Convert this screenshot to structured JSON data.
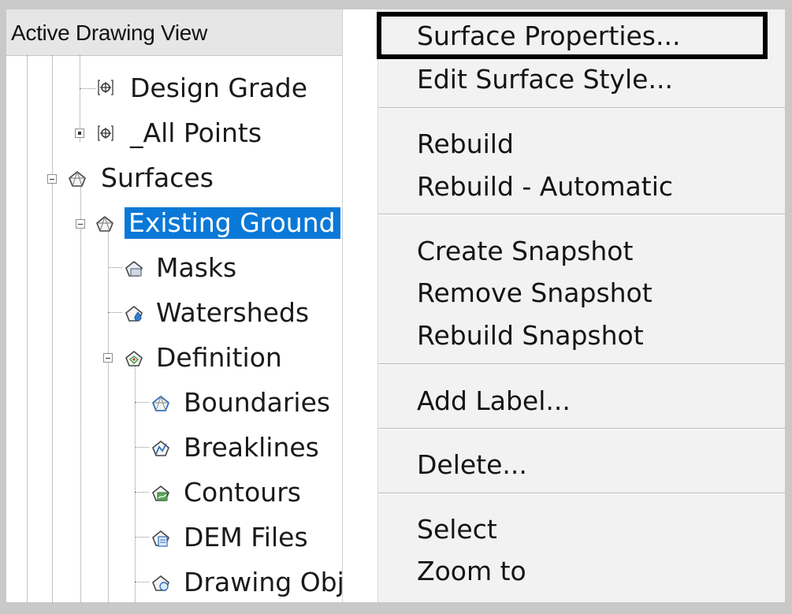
{
  "tree": {
    "header": "Active Drawing View",
    "items": [
      {
        "label": "Design Grade",
        "icon": "point-group-icon"
      },
      {
        "label": "_All Points",
        "icon": "point-group-icon"
      },
      {
        "label": "Surfaces",
        "icon": "surfaces-icon"
      },
      {
        "label": "Existing Ground",
        "icon": "surface-icon",
        "selected": true
      },
      {
        "label": "Masks",
        "icon": "masks-icon"
      },
      {
        "label": "Watersheds",
        "icon": "watersheds-icon"
      },
      {
        "label": "Definition",
        "icon": "definition-icon"
      },
      {
        "label": "Boundaries",
        "icon": "boundaries-icon"
      },
      {
        "label": "Breaklines",
        "icon": "breaklines-icon"
      },
      {
        "label": "Contours",
        "icon": "contours-icon"
      },
      {
        "label": "DEM Files",
        "icon": "dem-files-icon"
      },
      {
        "label": "Drawing Obj",
        "icon": "drawing-objects-icon"
      }
    ]
  },
  "menu": {
    "items": [
      "Surface Properties...",
      "Edit Surface Style...",
      "Rebuild",
      "Rebuild - Automatic",
      "Create Snapshot",
      "Remove Snapshot",
      "Rebuild Snapshot",
      "Add Label...",
      "Delete...",
      "Select",
      "Zoom to"
    ],
    "highlighted": "Surface Properties..."
  },
  "colors": {
    "selection": "#0a78d7",
    "header_bg": "#e6e6e6",
    "menu_bg": "#f2f2f2",
    "frame": "#c9c9c9"
  }
}
